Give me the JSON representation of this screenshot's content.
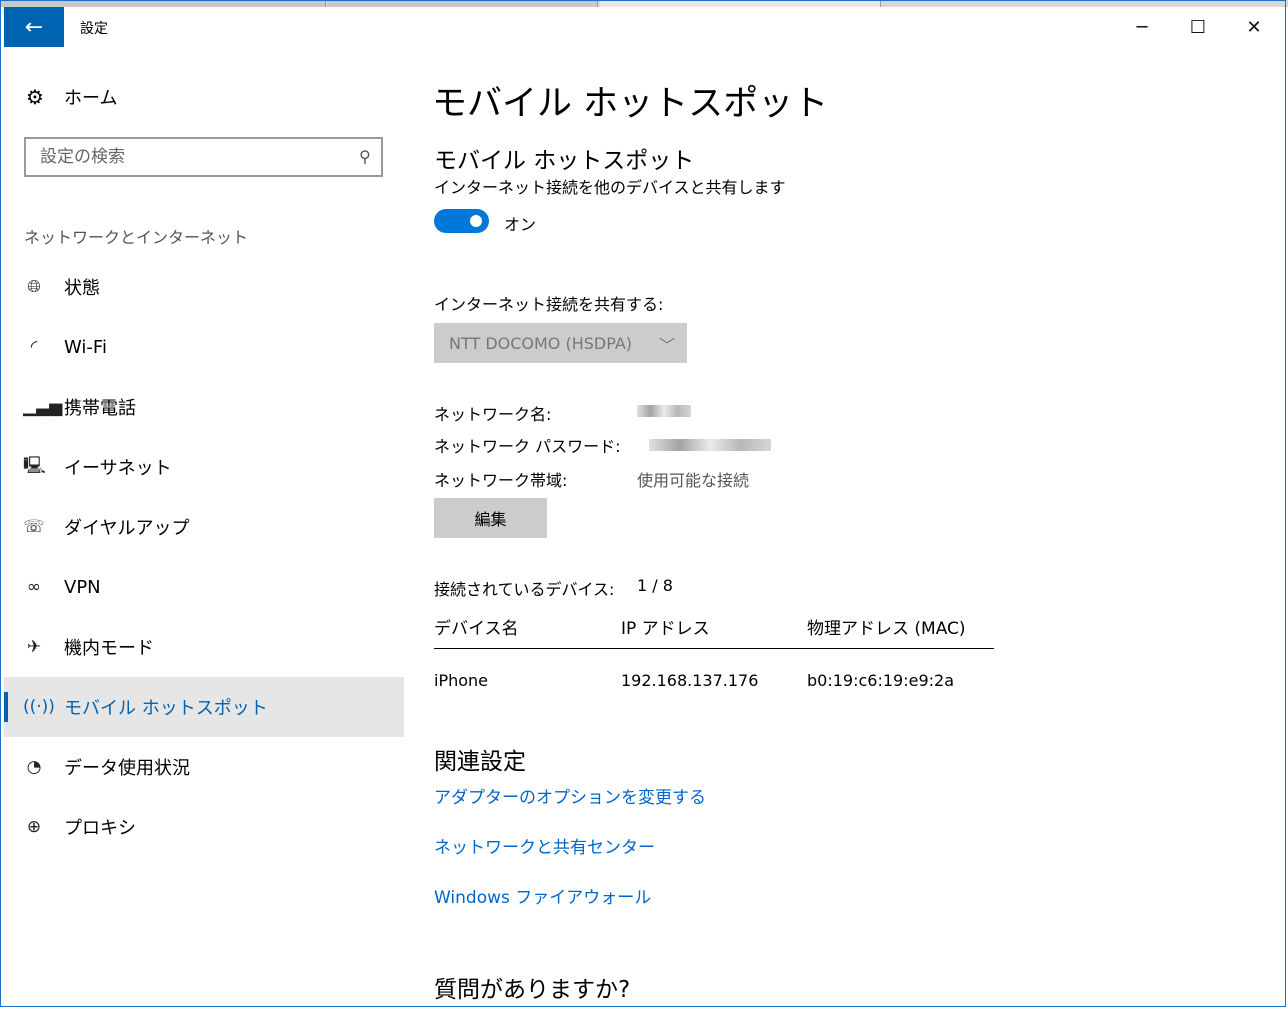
{
  "window": {
    "title": "設定",
    "back_icon": "←",
    "minimize_icon": "─",
    "maximize_icon": "☐",
    "close_icon": "✕"
  },
  "sidebar": {
    "home_label": "ホーム",
    "search_placeholder": "設定の検索",
    "section_heading": "ネットワークとインターネット",
    "items": [
      {
        "label": "状態",
        "icon": "globe-status-icon"
      },
      {
        "label": "Wi-Fi",
        "icon": "wifi-icon"
      },
      {
        "label": "携帯電話",
        "icon": "signal-bars-icon"
      },
      {
        "label": "イーサネット",
        "icon": "ethernet-icon"
      },
      {
        "label": "ダイヤルアップ",
        "icon": "dialup-icon"
      },
      {
        "label": "VPN",
        "icon": "vpn-icon"
      },
      {
        "label": "機内モード",
        "icon": "airplane-icon"
      },
      {
        "label": "モバイル ホットスポット",
        "icon": "hotspot-icon",
        "active": true
      },
      {
        "label": "データ使用状況",
        "icon": "pie-chart-icon"
      },
      {
        "label": "プロキシ",
        "icon": "globe-icon"
      }
    ]
  },
  "main": {
    "page_title": "モバイル ホットスポット",
    "section_title": "モバイル ホットスポット",
    "description": "インターネット接続を他のデバイスと共有します",
    "toggle_state": "オン",
    "share_label": "インターネット接続を共有する:",
    "share_selected": "NTT DOCOMO (HSDPA)",
    "network_name_label": "ネットワーク名:",
    "network_password_label": "ネットワーク パスワード:",
    "network_band_label": "ネットワーク帯域:",
    "network_band_value": "使用可能な接続",
    "edit_button": "編集",
    "connected_label": "接続されているデバイス:",
    "connected_value": "1 / 8",
    "table": {
      "headers": [
        "デバイス名",
        "IP アドレス",
        "物理アドレス (MAC)"
      ],
      "rows": [
        [
          "iPhone",
          "192.168.137.176",
          "b0:19:c6:19:e9:2a"
        ]
      ]
    },
    "related_heading": "関連設定",
    "links": [
      "アダプターのオプションを変更する",
      "ネットワークと共有センター",
      "Windows ファイアウォール"
    ],
    "question_heading": "質問がありますか?"
  },
  "colors": {
    "accent": "#0063b1",
    "toggle": "#0078d7",
    "link": "#0066cc"
  }
}
